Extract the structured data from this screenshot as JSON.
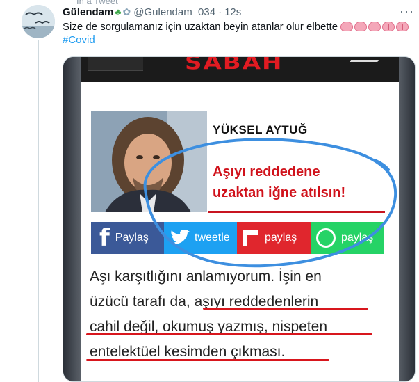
{
  "top_label": "In a Tweet",
  "tweet": {
    "name": "Gülendam",
    "handle": "@Gulendam_034",
    "separator": "·",
    "time": "12s",
    "text": "Size de sorgulamanız için uzaktan beyin atanlar olur elbette",
    "brain_emoji_count": 5,
    "hashtag": "#Covid",
    "more_label": "···"
  },
  "media": {
    "logo": "SABAH",
    "author": "YÜKSEL AYTUĞ",
    "headline_line1": "Aşıyı reddedene",
    "headline_line2": "uzaktan iğne atılsın!",
    "share": {
      "facebook": "Paylaş",
      "twitter": "tweetle",
      "flipboard": "paylaş",
      "whatsapp": "paylaş"
    },
    "article_lines": [
      "Aşı karşıtlığını anlamıyorum. İşin en",
      "üzücü tarafı da, aşıyı reddedenlerin",
      "cahil değil, okumuş yazmış, nispeten",
      "entelektüel kesimden çıkması."
    ]
  },
  "colors": {
    "accent": "#1d9bf0",
    "headline_red": "#d0121b",
    "annotation_blue": "#3d8fe0"
  }
}
